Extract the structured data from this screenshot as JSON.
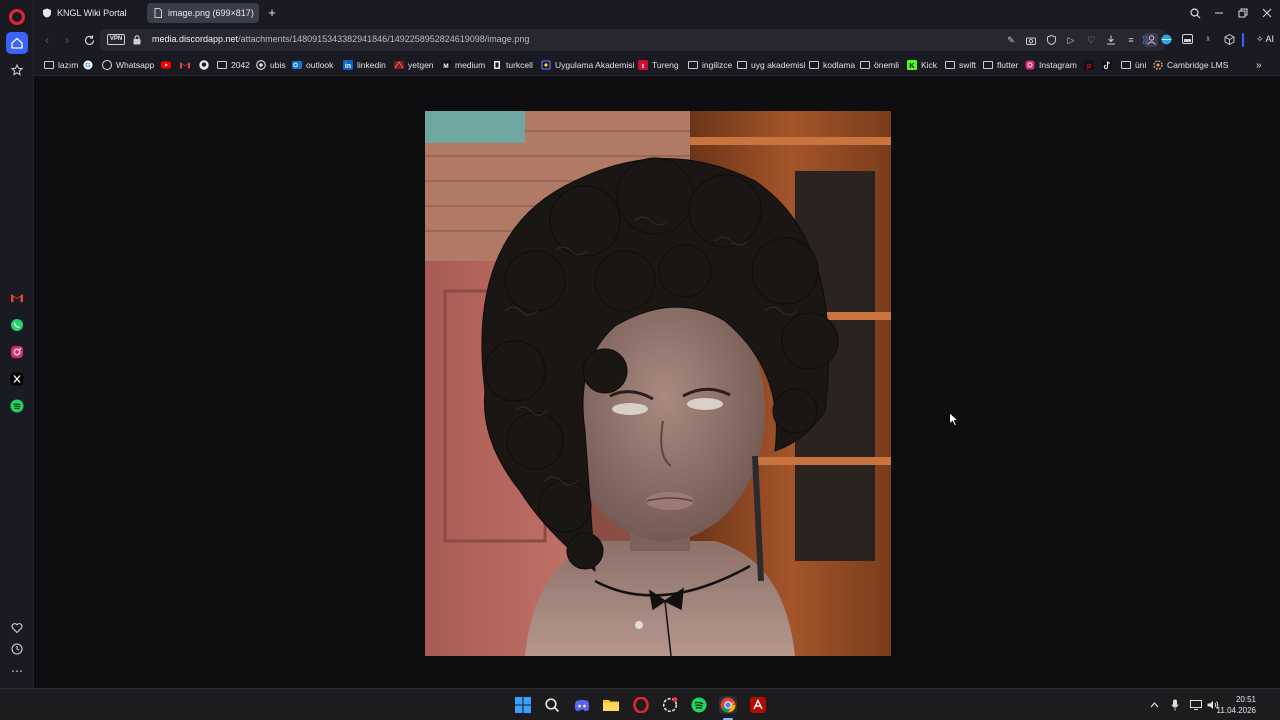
{
  "tabs": [
    {
      "title": "KNGL Wiki Portal",
      "active": false
    },
    {
      "title": "image.png (699×817)",
      "active": true
    }
  ],
  "address": {
    "vpn_label": "VPN",
    "url_host": "media.discordapp.net",
    "url_path": "/attachments/1480915343382941846/1492258952824619098/image.png",
    "ai_label": "AI"
  },
  "bookmarks": [
    {
      "label": "lazım",
      "icon": "folder-icon"
    },
    {
      "label": "",
      "icon": "google-icon"
    },
    {
      "label": "Whatsapp",
      "icon": "whatsapp-icon"
    },
    {
      "label": "",
      "icon": "youtube-icon"
    },
    {
      "label": "",
      "icon": "gmail-icon"
    },
    {
      "label": "",
      "icon": "github-icon"
    },
    {
      "label": "2042",
      "icon": "folder-icon"
    },
    {
      "label": "ubis",
      "icon": "ubis-icon"
    },
    {
      "label": "outlook",
      "icon": "outlook-icon"
    },
    {
      "label": "linkedin",
      "icon": "linkedin-icon"
    },
    {
      "label": "yetgen",
      "icon": "yetgen-icon"
    },
    {
      "label": "medium",
      "icon": "medium-icon"
    },
    {
      "label": "turkcell",
      "icon": "turkcell-icon"
    },
    {
      "label": "Uygulama Akademisi",
      "icon": "akademi-icon"
    },
    {
      "label": "Tureng",
      "icon": "tureng-icon"
    },
    {
      "label": "ingilizce",
      "icon": "folder-icon"
    },
    {
      "label": "uyg akademisi",
      "icon": "folder-icon"
    },
    {
      "label": "kodlama",
      "icon": "folder-icon"
    },
    {
      "label": "önemli",
      "icon": "folder-icon"
    },
    {
      "label": "Kick",
      "icon": "kick-icon"
    },
    {
      "label": "swift",
      "icon": "folder-icon"
    },
    {
      "label": "flutter",
      "icon": "folder-icon"
    },
    {
      "label": "Instagram",
      "icon": "instagram-icon"
    },
    {
      "label": "",
      "icon": "pinterest-icon"
    },
    {
      "label": "",
      "icon": "tiktok-icon"
    },
    {
      "label": "üni",
      "icon": "folder-icon"
    },
    {
      "label": "Cambridge LMS",
      "icon": "cambridge-icon"
    }
  ],
  "clock": {
    "time": "20:51",
    "date": "11.04.2026"
  },
  "colors": {
    "opera_red": "#e3262f",
    "sidebar_bg": "#1a1b22",
    "accent_blue": "#3a63ff"
  }
}
